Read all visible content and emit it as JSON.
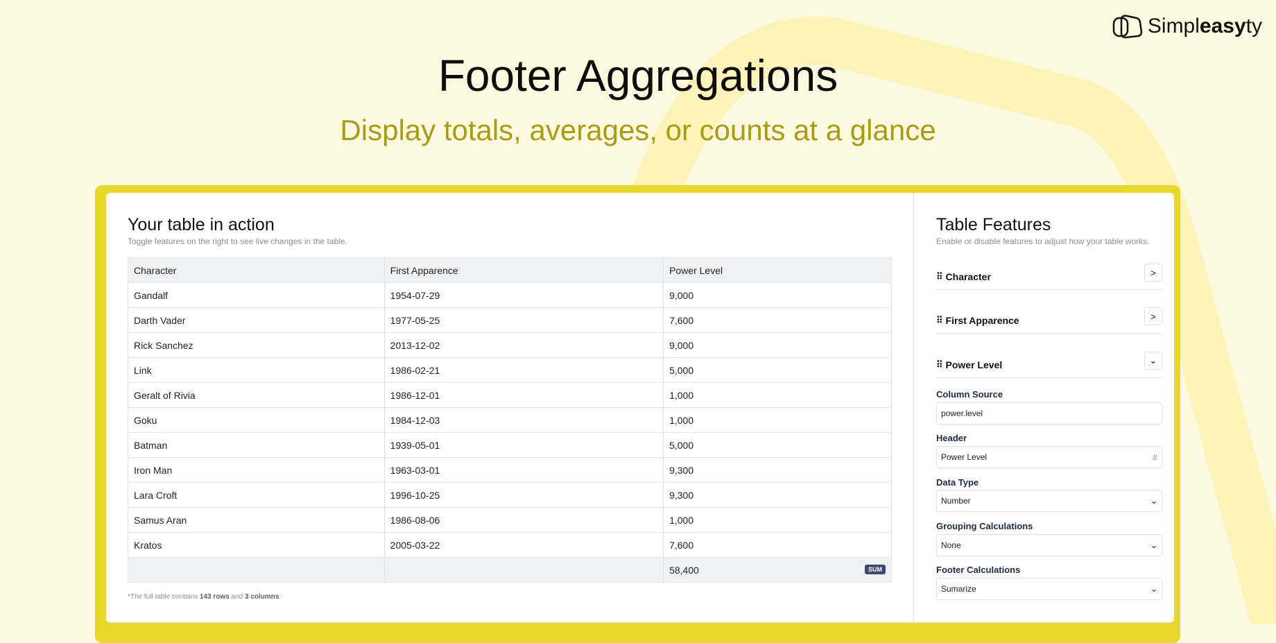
{
  "brand": {
    "name_pre": "Simpl",
    "name_bold": "easy",
    "name_post": "ty"
  },
  "hero": {
    "title": "Footer Aggregations",
    "subtitle": "Display totals, averages, or counts at a glance"
  },
  "left": {
    "title": "Your table in action",
    "hint": "Toggle features on the right to see live changes in the table.",
    "columns": [
      "Character",
      "First Apparence",
      "Power Level"
    ],
    "rows": [
      [
        "Gandalf",
        "1954-07-29",
        "9,000"
      ],
      [
        "Darth Vader",
        "1977-05-25",
        "7,600"
      ],
      [
        "Rick Sanchez",
        "2013-12-02",
        "9,000"
      ],
      [
        "Link",
        "1986-02-21",
        "5,000"
      ],
      [
        "Geralt of Rivia",
        "1986-12-01",
        "1,000"
      ],
      [
        "Goku",
        "1984-12-03",
        "1,000"
      ],
      [
        "Batman",
        "1939-05-01",
        "5,000"
      ],
      [
        "Iron Man",
        "1963-03-01",
        "9,300"
      ],
      [
        "Lara Croft",
        "1996-10-25",
        "9,300"
      ],
      [
        "Samus Aran",
        "1986-08-06",
        "1,000"
      ],
      [
        "Kratos",
        "2005-03-22",
        "7,600"
      ]
    ],
    "footer": {
      "total": "58,400",
      "badge": "SUM"
    },
    "note": {
      "pre": "*The full table contains ",
      "rows": "143 rows",
      "mid": " and ",
      "cols": "3 columns",
      "post": "."
    }
  },
  "right": {
    "title": "Table Features",
    "hint": "Enable or disable features to adjust how your table works.",
    "items": [
      "Character",
      "First Apparence",
      "Power Level"
    ],
    "fields": {
      "source_label": "Column Source",
      "source_value": "power.level",
      "header_label": "Header",
      "header_value": "Power Level",
      "type_label": "Data Type",
      "type_value": "Number",
      "group_label": "Grouping Calculations",
      "group_value": "None",
      "footer_label": "Footer Calculations",
      "footer_value": "Sumarize"
    }
  },
  "colors": {
    "accent": "#e9d82c",
    "subtitle": "#a99c12",
    "badge": "#3d4a6b"
  }
}
